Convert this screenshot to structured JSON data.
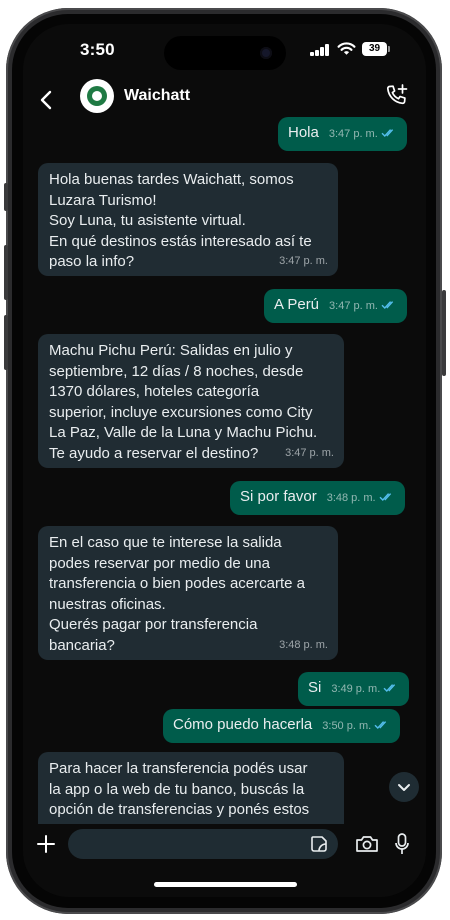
{
  "status": {
    "time": "3:50",
    "battery": "39"
  },
  "header": {
    "contact_name": "Waichatt"
  },
  "messages": [
    {
      "dir": "out",
      "text": "Hola",
      "time": "3:47 p. m."
    },
    {
      "dir": "in",
      "text": "Hola buenas tardes Waichatt, somos\nLuzara Turismo!\nSoy Luna, tu asistente virtual.\nEn qué destinos estás interesado así te\npaso la info?",
      "time": "3:47 p. m."
    },
    {
      "dir": "out",
      "text": "A Perú",
      "time": "3:47 p. m."
    },
    {
      "dir": "in",
      "text": "Machu Pichu Perú: Salidas en julio y\nseptiembre, 12 días / 8 noches, desde\n1370 dólares, hoteles categoría\nsuperior, incluye excursiones como City\nLa Paz, Valle de la Luna y Machu Pichu.\nTe ayudo a reservar el destino?",
      "time": "3:47 p. m."
    },
    {
      "dir": "out",
      "text": "Si por favor",
      "time": "3:48 p. m."
    },
    {
      "dir": "in",
      "text": "En el caso que te interese la salida\npodes reservar por medio de una\ntransferencia  o bien podes acercarte a\nnuestras oficinas.\nQuerés pagar por transferencia\nbancaria?",
      "time": "3:48 p. m."
    },
    {
      "dir": "out",
      "text": "Si",
      "time": "3:49 p. m."
    },
    {
      "dir": "out",
      "text": "Cómo puedo hacerla",
      "time": "3:50 p. m."
    },
    {
      "dir": "in",
      "text": "Para hacer la transferencia podés usar\nla app o la web de tu banco, buscás la\nopción de transferencias y ponés estos",
      "time": ""
    }
  ],
  "composer": {
    "placeholder": ""
  },
  "icons": {
    "back": "chevron-left-icon",
    "call": "add-call-icon",
    "plus": "plus-icon",
    "sticker": "sticker-icon",
    "camera": "camera-icon",
    "mic": "microphone-icon",
    "scroll": "chevron-down-icon"
  },
  "colors": {
    "incoming_bubble": "#202c33",
    "outgoing_bubble": "#005c4b",
    "read_ticks": "#53bdeb",
    "background": "#0b0b0b"
  }
}
